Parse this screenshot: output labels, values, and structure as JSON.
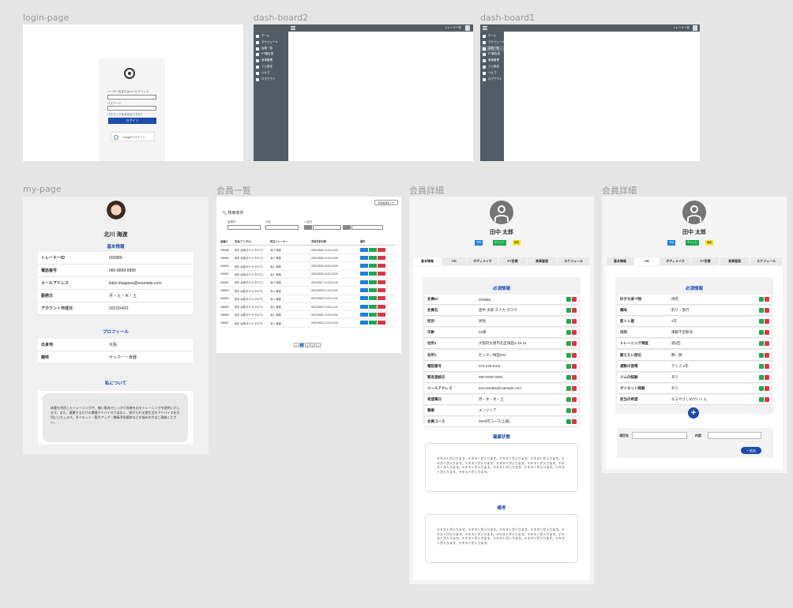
{
  "frames": {
    "login": "login-page",
    "dash2": "dash-board2",
    "dash1": "dash-board1",
    "mypage": "my-page",
    "members": "会員一覧",
    "detail1": "会員詳細",
    "detail2": "会員詳細"
  },
  "login": {
    "user_label": "ユーザー名またはメールアドレス",
    "password_label": "パスワード",
    "forgot": "パスワードをお忘れですか？",
    "login_button": "ログイン",
    "google_button": "Googleでログイン"
  },
  "dashboard": {
    "user": "トレーナー名",
    "items": [
      "ホーム",
      "スケジュール",
      "会員一覧",
      "PT報告書",
      "食事管理",
      "ジム設定",
      "ヘルプ",
      "ログアウト"
    ]
  },
  "mypage": {
    "name": "北川 海渡",
    "basic_title": "基本情報",
    "basic": [
      {
        "k": "トレーナーID",
        "v": "000888"
      },
      {
        "k": "電話番号",
        "v": "080-8888-8888"
      },
      {
        "k": "メールアドレス",
        "v": "kaito.kitagawa@example.com"
      },
      {
        "k": "勤務日",
        "v": "月・火・木・土"
      },
      {
        "k": "アカウント作成日",
        "v": "2022/04/01"
      }
    ],
    "profile_title": "プロフィール",
    "profile": [
      {
        "k": "出身地",
        "v": "大阪"
      },
      {
        "k": "趣味",
        "v": "サッカー・食器"
      }
    ],
    "about_title": "私について",
    "about": "体重を利用したトレーニングや、細い筋肉でしっかり効果を出せトレーニングを提供いたします。また、健康するだけの素晴アドバイスではなく、続けられる食生活のアドバイスを大切にいたします。ダイエット・筋力アップ・膝痛予防緩和などお悩みの方はご連絡ください。"
  },
  "members": {
    "search_button": "新規会員を入力",
    "search_title": "検索条件",
    "fields": [
      "会員ID",
      "氏名",
      "性別",
      "入会日"
    ],
    "headers": [
      "会員ID",
      "氏名(フリガナ)",
      "担当トレーナー",
      "次回予約日時",
      "操作"
    ],
    "rows": [
      [
        "000888",
        "田中 太郎(タナカ タロウ)",
        "北川 海渡",
        "2022/05/25 12:00-13:00"
      ],
      [
        "000889",
        "田中 太郎(タナカ タロウ)",
        "北川 海渡",
        "2022/05/26 12:00-13:00"
      ],
      [
        "000890",
        "田中 太郎(タナカ タロウ)",
        "北川 海渡",
        "2022/05/26 15:00-16:00"
      ],
      [
        "000891",
        "田中 太郎(タナカ タロウ)",
        "北川 海渡",
        "2022/05/26 18:00-19:00"
      ],
      [
        "000892",
        "田中 太郎(タナカ タロウ)",
        "北川 海渡",
        "2022/05/27 10:00-11:00"
      ],
      [
        "000893",
        "田中 太郎(タナカ タロウ)",
        "北川 海渡",
        "2022/05/28 12:00-13:00"
      ],
      [
        "000894",
        "田中 太郎(タナカ タロウ)",
        "北川 海渡",
        "2022/05/28 13:00-14:00"
      ],
      [
        "000895",
        "田中 太郎(タナカ タロウ)",
        "北川 海渡",
        "2022/05/29 10:00-11:00"
      ],
      [
        "000896",
        "田中 太郎(タナカ タロウ)",
        "北川 海渡",
        "2022/05/30 12:00-13:00"
      ],
      [
        "000897",
        "田中 太郎(タナカ タロウ)",
        "北川 海渡",
        "2022/05/31 12:00-13:00"
      ]
    ],
    "pages": [
      "<",
      "1",
      "2",
      "3",
      ">"
    ]
  },
  "detail": {
    "name": "田中 太郎",
    "badges": [
      "予約",
      "チャット",
      "編集"
    ],
    "tabs": [
      "基本情報",
      "PR",
      "ボディメイク",
      "PT目標",
      "食事管理",
      "スケジュール"
    ],
    "required_title": "必須情報",
    "rows": [
      {
        "k": "会員ID",
        "v": "000888"
      },
      {
        "k": "会員名",
        "v": "田中 太郎 タナカ タロウ"
      },
      {
        "k": "性別",
        "v": "男性"
      },
      {
        "k": "年齢",
        "v": "33歳"
      },
      {
        "k": "住所1",
        "v": "大阪府大阪市北区梅田3-15-15"
      },
      {
        "k": "住所2",
        "v": "センタン梅田201"
      },
      {
        "k": "電話番号",
        "v": "072-426-5411"
      },
      {
        "k": "緊急連絡先",
        "v": "090-0000-0000"
      },
      {
        "k": "メールアドレス",
        "v": "taro.tanaka@example.com"
      },
      {
        "k": "希望曜日",
        "v": "月・水・木・土"
      },
      {
        "k": "職業",
        "v": "エンジニア"
      },
      {
        "k": "会員コース",
        "v": "3000円コース(上級)"
      }
    ],
    "health_title": "健康状態",
    "health_text": "テキストが入ります。テキストが入ります。テキストが入ります。テキストが入ります。テキストが入ります。テキストが入ります。テキストが入ります。テキストが入ります。テキストが入ります。テキストが入ります。テキストが入ります。テキストが入ります。テキストが入ります。テキストが入ります。",
    "notes_title": "備考",
    "notes_text": "テキストが入ります。テキストが入ります。テキストが入ります。テキストが入ります。テキストが入ります。テキストが入ります。テキストが入ります。テキストが入ります。テキストが入ります。テキストが入ります。テキストが入ります。テキストが入ります。テキストが入ります。テキストが入ります。"
  },
  "pr": {
    "name": "田中 太郎",
    "required_title": "必須情報",
    "rows": [
      {
        "k": "好きな食べ物",
        "v": "焼肉"
      },
      {
        "k": "趣味",
        "v": "釣り・旅行"
      },
      {
        "k": "筋トレ歴",
        "v": "2年"
      },
      {
        "k": "目的",
        "v": "運動不足解消"
      },
      {
        "k": "トレーニング頻度",
        "v": "週2回"
      },
      {
        "k": "鍛えたい部位",
        "v": "胸・腕"
      },
      {
        "k": "運動の習慣",
        "v": "テニス 2年"
      },
      {
        "k": "ジムの経験",
        "v": "あり"
      },
      {
        "k": "ダイエット経験",
        "v": "あり"
      },
      {
        "k": "担当の希望",
        "v": "なるやさしめがいくん"
      }
    ],
    "item_label": "項目名",
    "content_label": "内容",
    "add_button": "追加"
  },
  "colors": {
    "accent": "#1e4aa8",
    "sidebar": "#525c64",
    "green": "#1faa4a",
    "red": "#e0334a",
    "yellow": "#f5e623"
  }
}
